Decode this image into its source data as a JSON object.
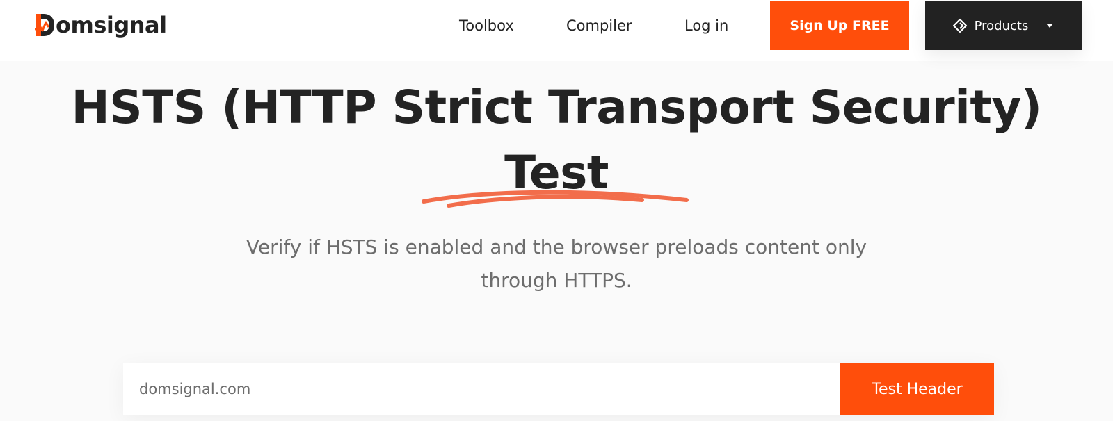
{
  "header": {
    "logo_text": "omsignal",
    "logo_icon": "domsignal-d-logo-icon",
    "nav": {
      "toolbox": "Toolbox",
      "compiler": "Compiler",
      "login": "Log in"
    },
    "signup_label": "Sign Up FREE",
    "products_label": "Products",
    "products_icon": "diamond-arrows-icon",
    "products_caret_icon": "caret-down-icon"
  },
  "hero": {
    "title_line1": "HSTS (HTTP Strict Transport Security)",
    "title_line2": "Test",
    "subtitle_line1": "Verify if HSTS is enabled and the browser preloads content only",
    "subtitle_line2": "through HTTPS."
  },
  "search": {
    "placeholder": "domsignal.com",
    "button_label": "Test Header"
  },
  "colors": {
    "accent": "#ff4e0b",
    "dark": "#222222",
    "text": "#232323",
    "muted": "#6d6d6d",
    "underline": "#f26d4b"
  }
}
